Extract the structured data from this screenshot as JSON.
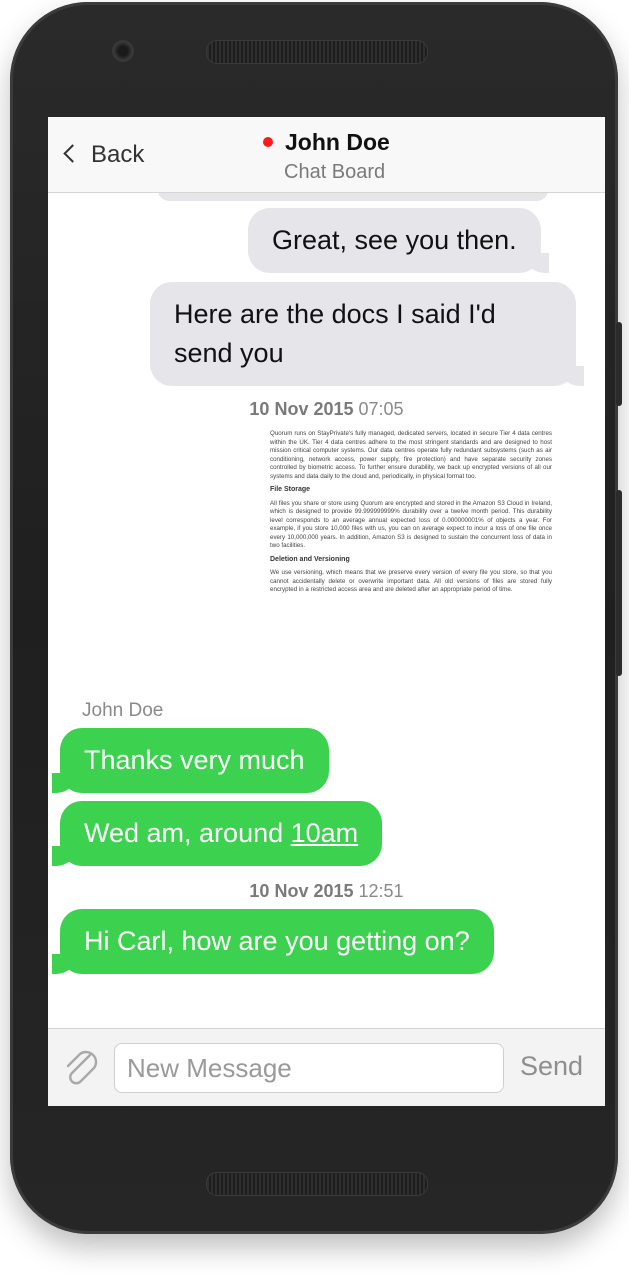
{
  "header": {
    "back_label": "Back",
    "contact_name": "John Doe",
    "subtitle": "Chat Board",
    "status_color": "#ff1a1a"
  },
  "messages": {
    "out1": "Great, see you then.",
    "out2": "Here are the docs I said I'd send you",
    "timestamp1_date": "10 Nov 2015",
    "timestamp1_time": "07:05",
    "sender": "John Doe",
    "in1": "Thanks very much",
    "in2_prefix": "Wed am, around ",
    "in2_link": "10am",
    "timestamp2_date": "10 Nov 2015",
    "timestamp2_time": "12:51",
    "in3": "Hi Carl, how are you getting on?"
  },
  "document": {
    "p1": "Quorum runs on StayPrivate's fully managed, dedicated servers, located in secure Tier 4 data centres within the UK. Tier 4 data centres adhere to the most stringent standards and are designed to host mission critical computer systems. Our data centres operate fully redundant subsystems (such as air conditioning, network access, power supply, fire protection) and have separate security zones controlled by biometric access. To further ensure durability, we back up encrypted versions of all our systems and data daily to the cloud and, periodically, in physical format too.",
    "h1": "File Storage",
    "p2": "All files you share or store using Quorum are encrypted and stored in the Amazon S3 Cloud in Ireland, which is designed to provide 99.999999999% durability over a twelve month period. This durability level corresponds to an average annual expected loss of 0.000000001% of objects a year. For example, if you store 10,000 files with us, you can on average expect to incur a loss of one file once every 10,000,000 years. In addition, Amazon S3 is designed to sustain the concurrent loss of data in two facilities.",
    "h2": "Deletion and Versioning",
    "p3": "We use versioning, which means that we preserve every version of every file you store, so that you cannot accidentally delete or overwrite important data. All old versions of files are stored fully encrypted in a restricted access area and are deleted after an appropriate period of time."
  },
  "composer": {
    "placeholder": "New Message",
    "send_label": "Send"
  },
  "colors": {
    "incoming_bubble": "#3cd14f",
    "outgoing_bubble": "#e5e5ea"
  },
  "icons": {
    "back": "chevron-left-icon",
    "attach": "paperclip-icon",
    "status": "online-dot-icon"
  }
}
